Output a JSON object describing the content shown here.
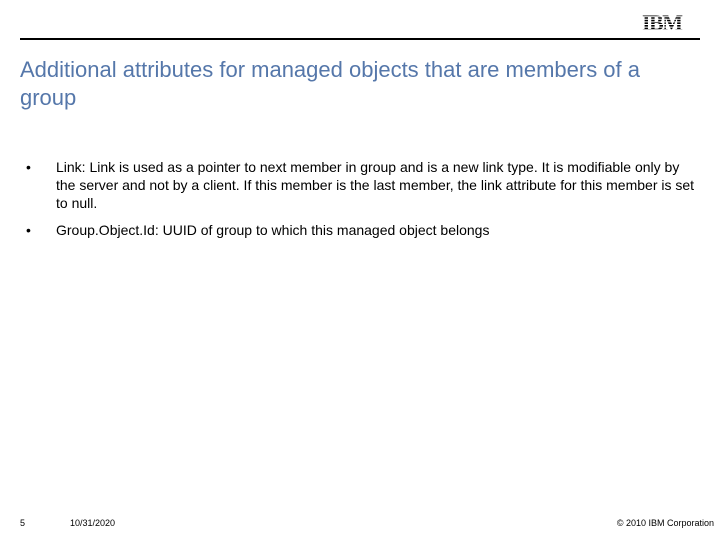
{
  "logo_name": "ibm-logo",
  "title": "Additional attributes for managed objects that are members of a group",
  "bullets": [
    "Link: Link is used as a pointer to next member in group and is a new link type. It is modifiable only by the server and not by a client. If this member is the last member, the link attribute for this member is set to null.",
    "Group.Object.Id: UUID of group to which this managed object belongs"
  ],
  "footer": {
    "page_number": "5",
    "date": "10/31/2020",
    "copyright": "© 2010 IBM Corporation"
  }
}
